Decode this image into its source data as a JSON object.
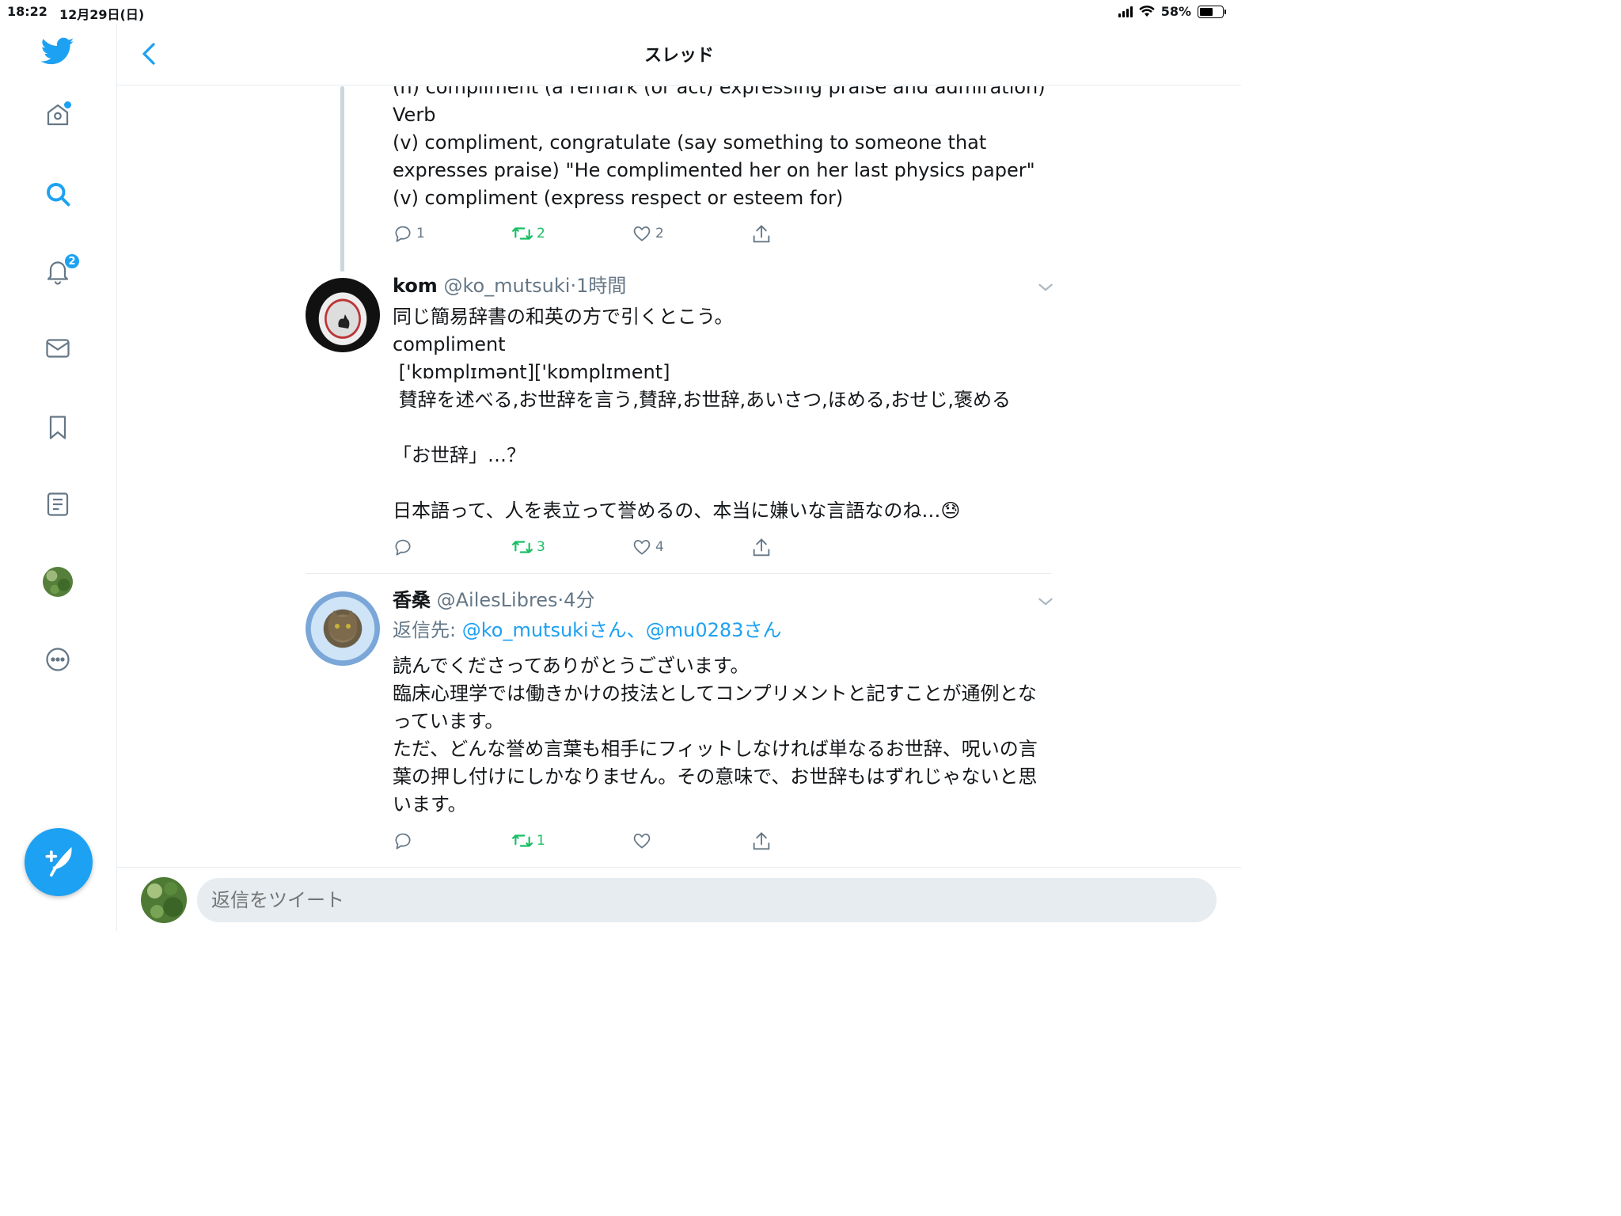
{
  "status_bar": {
    "time": "18:22",
    "date": "12月29日(日)",
    "battery": "58%",
    "battery_level": 0.58
  },
  "header": {
    "title": "スレッド"
  },
  "sidebar": {
    "notifications_badge": "2",
    "items": [
      "twitter-logo",
      "home-icon",
      "search-icon",
      "notifications-icon",
      "messages-icon",
      "bookmarks-icon",
      "lists-icon",
      "profile-avatar",
      "more-icon"
    ]
  },
  "tweets": [
    {
      "lines": [
        "(n) compliment (a remark (or act) expressing praise and admiration)",
        "Verb",
        "(v) compliment, congratulate (say something to someone that",
        "expresses praise) \"He complimented her on her last physics paper\"",
        "(v) compliment (express respect or esteem for)"
      ],
      "replies": "1",
      "retweets": "2",
      "likes": "2"
    },
    {
      "name": "kom",
      "handle": "@ko_mutsuki",
      "time": "·1時間",
      "lines": [
        "同じ簡易辞書の和英の方で引くとこう。",
        "compliment",
        " ['kɒmplɪmənt]['kɒmplɪment]",
        " 賛辞を述べる,お世辞を言う,賛辞,お世辞,あいさつ,ほめる,おせじ,褒める",
        "",
        "「お世辞」…？",
        "",
        "日本語って、人を表立って誉めるの、本当に嫌いな言語なのね…😓"
      ],
      "replies": "",
      "retweets": "3",
      "likes": "4"
    },
    {
      "name": "香桑",
      "handle": "@AilesLibres",
      "time": "·4分",
      "reply_label": "返信先: ",
      "reply_mentions": "@ko_mutsukiさん、@mu0283さん",
      "lines": [
        "読んでくださってありがとうございます。",
        "臨床心理学では働きかけの技法としてコンプリメントと記すことが通例とな",
        "っています。",
        "ただ、どんな誉め言葉も相手にフィットしなければ単なるお世辞、呪いの言",
        "葉の押し付けにしかなりません。その意味で、お世辞もはずれじゃないと思",
        "います。"
      ],
      "replies": "",
      "retweets": "1",
      "likes": ""
    }
  ],
  "reply_bar": {
    "placeholder": "返信をツイート"
  },
  "colors": {
    "accent": "#1da1f2",
    "retweet": "#17bf63",
    "muted": "#657786",
    "border": "#e6ecf0"
  }
}
